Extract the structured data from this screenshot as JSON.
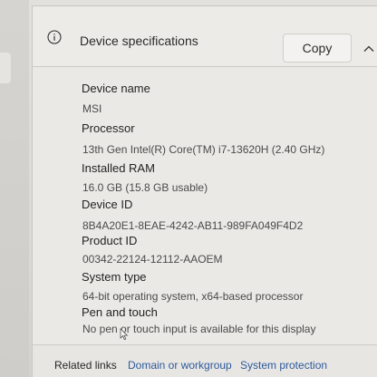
{
  "header": {
    "title": "Device specifications",
    "copy_label": "Copy",
    "info_icon": "info-icon",
    "collapse_icon": "chevron-up-icon"
  },
  "specs": [
    {
      "label": "Device name",
      "value": "MSI"
    },
    {
      "label": "Processor",
      "value": "13th Gen Intel(R) Core(TM) i7-13620H (2.40 GHz)"
    },
    {
      "label": "Installed RAM",
      "value": "16.0 GB (15.8 GB usable)"
    },
    {
      "label": "Device ID",
      "value": "8B4A20E1-8EAE-4242-AB11-989FA049F4D2"
    },
    {
      "label": "Product ID",
      "value": "00342-22124-12112-AAOEM"
    },
    {
      "label": "System type",
      "value": "64-bit operating system, x64-based processor"
    },
    {
      "label": "Pen and touch",
      "value": "No pen or touch input is available for this display"
    }
  ],
  "footer": {
    "related_label": "Related links",
    "links": [
      {
        "label": "Domain or workgroup"
      },
      {
        "label": "System protection"
      }
    ]
  },
  "colors": {
    "link": "#2d5a9c",
    "card_bg": "#ebe9e6"
  }
}
